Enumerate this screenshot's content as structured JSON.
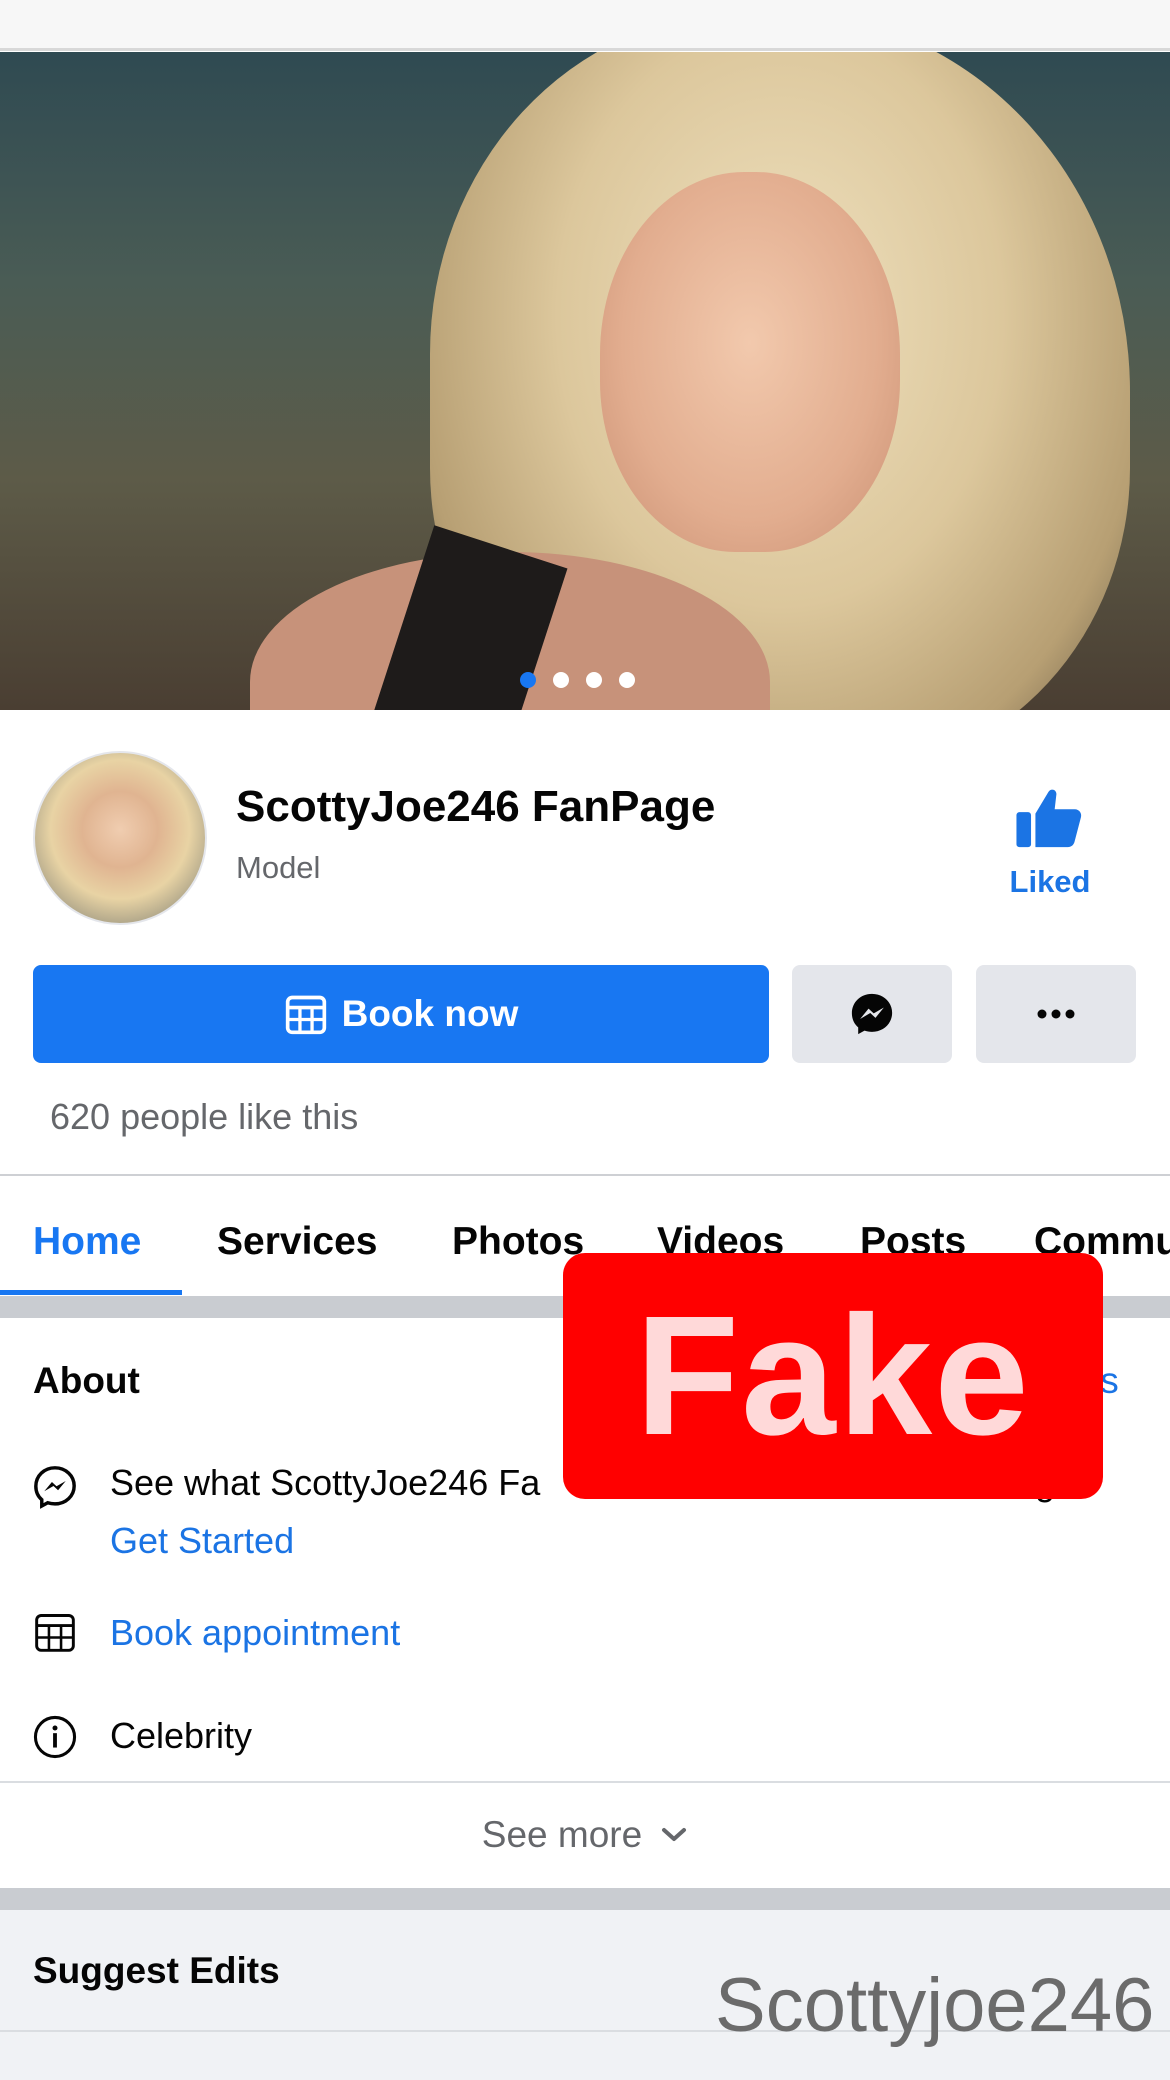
{
  "cover": {
    "slide_count": 4,
    "active_slide": 1
  },
  "profile": {
    "name": "ScottyJoe246 FanPage",
    "category": "Model",
    "liked_label": "Liked"
  },
  "actions": {
    "book_now": "Book now",
    "messenger_icon": "messenger-icon",
    "more_icon": "more-icon"
  },
  "likes_text": "620 people like this",
  "tabs": [
    "Home",
    "Services",
    "Photos",
    "Videos",
    "Posts",
    "Commu"
  ],
  "about": {
    "title": "About",
    "right_link": "ts",
    "rows": {
      "messenger_text": "See what ScottyJoe246 Fa",
      "messenger_tail": "g",
      "get_started": "Get Started",
      "book_appointment": "Book appointment",
      "category": "Celebrity"
    }
  },
  "overlay": {
    "fake_label": "Fake"
  },
  "see_more": "See more",
  "suggest_edits": "Suggest Edits",
  "watermark": "Scottyjoe246",
  "colors": {
    "accent": "#1877f2",
    "fake_bg": "#ff0000"
  }
}
